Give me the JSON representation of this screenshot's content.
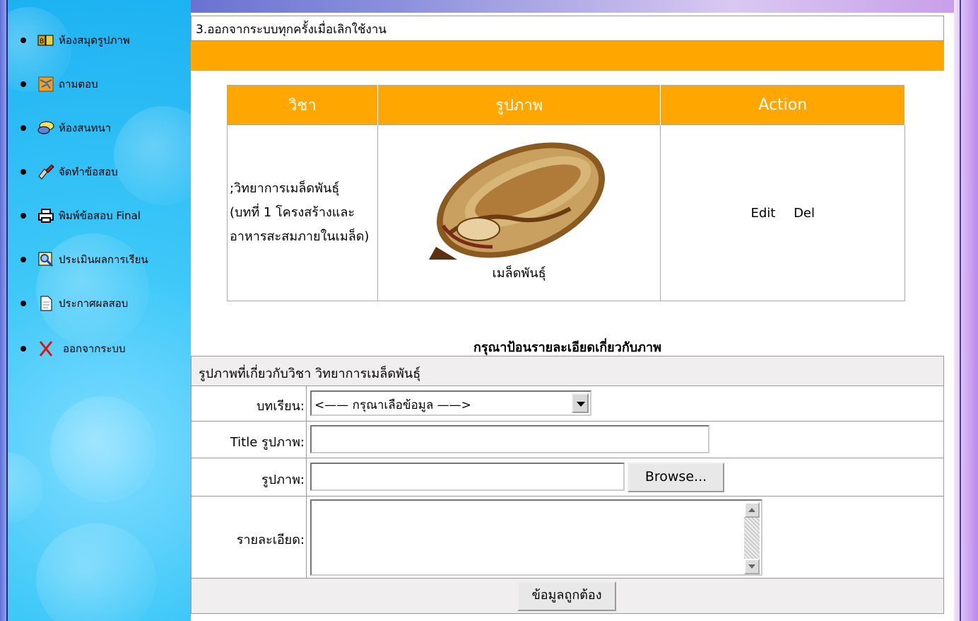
{
  "sidebar": {
    "items": [
      {
        "label": "ห้องสมุดรูปภาพ",
        "icon": "book-icon"
      },
      {
        "label": "ถามตอบ",
        "icon": "map-icon"
      },
      {
        "label": "ห้องสนทนา",
        "icon": "chat-icon"
      },
      {
        "label": "จัดทำข้อสอบ",
        "icon": "pen-icon"
      },
      {
        "label": "พิมพ์ข้อสอบ Final",
        "icon": "printer-icon"
      },
      {
        "label": "ประเมินผลการเรียน",
        "icon": "magnifier-icon"
      },
      {
        "label": "ประกาศผลสอบ",
        "icon": "document-icon"
      },
      {
        "label": "ออกจากระบบ",
        "icon": "exit-x-icon"
      }
    ]
  },
  "notice": {
    "text": "3.ออกจากระบบทุกครั้งเมื่อเลิกใช้งาน"
  },
  "list_table": {
    "headers": [
      "วิชา",
      "รูปภาพ",
      "Action"
    ],
    "rows": [
      {
        "subject_line1": ";วิทยาการเมล็ดพันธุ์",
        "subject_line2": "(บทที่ 1 โครงสร้างและ",
        "subject_line3": "อาหารสะสมภายในเมล็ด)",
        "image_caption": "เมล็ดพันธุ์",
        "edit_label": "Edit",
        "del_label": "Del"
      }
    ]
  },
  "form": {
    "heading": "กรุณาป้อนรายละเอียดเกี่ยวกับภาพ",
    "subject_row": "รูปภาพที่เกี่ยวกับวิชา วิทยาการเมล็ดพันธุ์",
    "lesson_label": "บทเรียน:",
    "lesson_selected": "<—— กรุณาเลือข้อมูล ——>",
    "title_label": "Title รูปภาพ:",
    "title_value": "",
    "image_label": "รูปภาพ:",
    "image_value": "",
    "browse_label": "Browse...",
    "detail_label": "รายละเอียด:",
    "detail_value": "",
    "submit_label": "ข้อมูลถูกต้อง"
  },
  "colors": {
    "orange": "#ffa600",
    "sidebar_blue": "#1cb2f2"
  }
}
